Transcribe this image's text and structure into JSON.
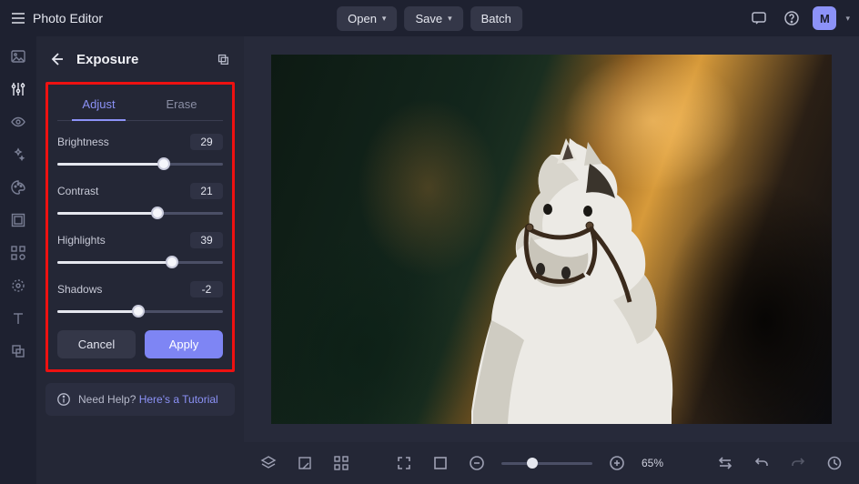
{
  "app": {
    "title": "Photo Editor"
  },
  "topbar": {
    "open": "Open",
    "save": "Save",
    "batch": "Batch",
    "avatar": "M"
  },
  "panel": {
    "title": "Exposure",
    "tabs": {
      "adjust": "Adjust",
      "erase": "Erase"
    },
    "sliders": {
      "brightness": {
        "label": "Brightness",
        "value": 29,
        "min": -100,
        "max": 100
      },
      "contrast": {
        "label": "Contrast",
        "value": 21,
        "min": -100,
        "max": 100
      },
      "highlights": {
        "label": "Highlights",
        "value": 39,
        "min": -100,
        "max": 100
      },
      "shadows": {
        "label": "Shadows",
        "value": -2,
        "min": -100,
        "max": 100
      }
    },
    "cancel": "Cancel",
    "apply": "Apply",
    "help_prefix": "Need Help? ",
    "help_link": "Here's a Tutorial"
  },
  "bottombar": {
    "zoom": "65%"
  }
}
